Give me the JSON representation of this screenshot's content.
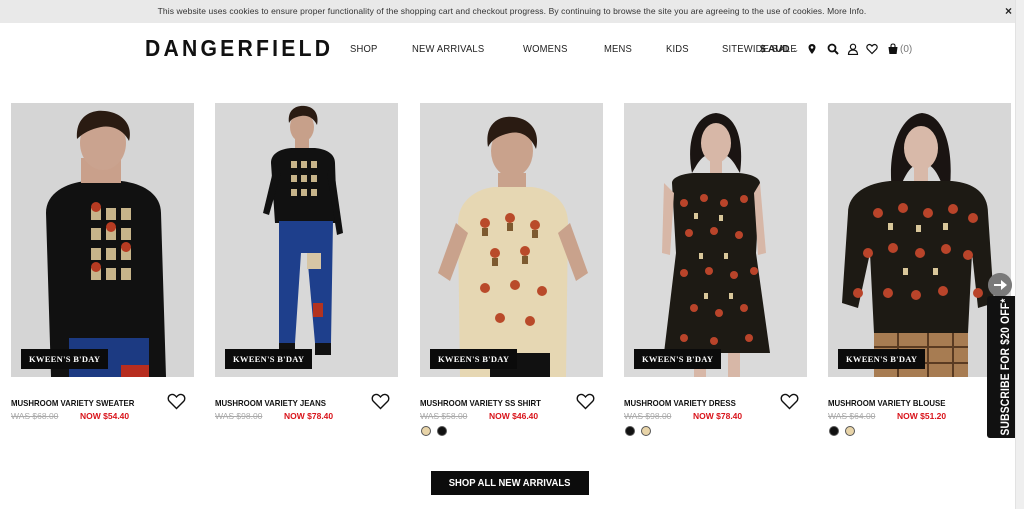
{
  "cookie_bar": {
    "text": "This website uses cookies to ensure proper functionality of the shopping cart and checkout progress. By continuing to browse the site you are agreeing to the use of cookies. More Info.",
    "close": "×"
  },
  "header": {
    "logo": "DANGERFIELD",
    "nav": [
      "SHOP",
      "NEW ARRIVALS",
      "WOMENS",
      "MENS",
      "KIDS",
      "SITEWIDE SALE"
    ],
    "currency": "$ AUD",
    "cart_count": "(0)",
    "icons": [
      "location-icon",
      "search-icon",
      "account-icon",
      "wishlist-icon",
      "cart-icon"
    ]
  },
  "products": [
    {
      "name": "MUSHROOM VARIETY SWEATER",
      "was": "WAS $68.00",
      "now": "NOW $54.40",
      "badge": "KWEEN'S B'DAY",
      "swatches": []
    },
    {
      "name": "MUSHROOM VARIETY JEANS",
      "was": "WAS $98.00",
      "now": "NOW $78.40",
      "badge": "KWEEN'S B'DAY",
      "swatches": []
    },
    {
      "name": "MUSHROOM VARIETY SS SHIRT",
      "was": "WAS $58.00",
      "now": "NOW $46.40",
      "badge": "KWEEN'S B'DAY",
      "swatches": [
        "#e8d4a8",
        "#111111"
      ]
    },
    {
      "name": "MUSHROOM VARIETY DRESS",
      "was": "WAS $98.00",
      "now": "NOW $78.40",
      "badge": "KWEEN'S B'DAY",
      "swatches": [
        "#111111",
        "#e8d4a8"
      ]
    },
    {
      "name": "MUSHROOM VARIETY BLOUSE",
      "was": "WAS $64.00",
      "now": "NOW $51.20",
      "badge": "KWEEN'S B'DAY",
      "swatches": [
        "#111111",
        "#e8d4a8"
      ]
    }
  ],
  "subscribe_tab": "SUBSCRIBE FOR $20 OFF*",
  "shop_all_button": "SHOP ALL NEW ARRIVALS",
  "colors": {
    "sale_red": "#d9141b",
    "black": "#0c0c0c",
    "cookie_bg": "#e9e9e9"
  }
}
